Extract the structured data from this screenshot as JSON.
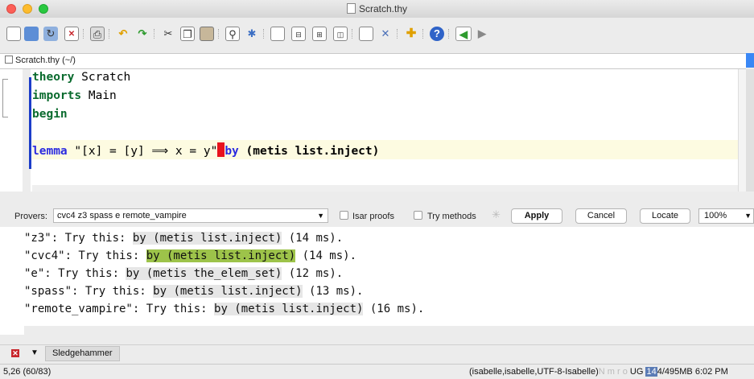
{
  "window": {
    "title": "Scratch.thy"
  },
  "toolbar": {
    "icons": [
      "new-file-icon",
      "open-file-icon",
      "reload-icon",
      "close-file-icon",
      "print-icon",
      "undo-icon",
      "redo-icon",
      "cut-icon",
      "copy-icon",
      "paste-icon",
      "find-icon",
      "find-replace-icon",
      "new-view-icon",
      "fold-icon",
      "unfold-icon",
      "split-icon",
      "buffer-icon",
      "tools-icon",
      "plugin-icon",
      "help-icon",
      "back-icon",
      "forward-icon"
    ]
  },
  "buffer_tab": {
    "label": "Scratch.thy (~/)"
  },
  "editor": {
    "lines": [
      {
        "kw": "theory",
        "rest": " Scratch"
      },
      {
        "kw": "imports",
        "rest": " Main"
      },
      {
        "kw": "begin",
        "rest": ""
      }
    ],
    "lemma": {
      "kw": "lemma",
      "statement": " \"[x] = [y] ⟹ x = y\"",
      "by_kw": "by",
      "method": " (metis list.inject)"
    }
  },
  "sledgehammer": {
    "provers_label": "Provers:",
    "provers_value": "cvc4 z3 spass e remote_vampire",
    "isar_proofs_label": "Isar proofs",
    "try_methods_label": "Try methods",
    "apply_label": "Apply",
    "cancel_label": "Cancel",
    "locate_label": "Locate",
    "zoom": "100%",
    "results": [
      {
        "prefix": "\"z3\": Try this: ",
        "method": "by (metis list.inject)",
        "suffix": " (14 ms).",
        "active": false
      },
      {
        "prefix": "\"cvc4\": Try this: ",
        "method": "by (metis list.inject)",
        "suffix": " (14 ms).",
        "active": true
      },
      {
        "prefix": "\"e\": Try this: ",
        "method": "by (metis the_elem_set)",
        "suffix": " (12 ms).",
        "active": false
      },
      {
        "prefix": "\"spass\": Try this: ",
        "method": "by (metis list.inject)",
        "suffix": " (13 ms).",
        "active": false
      },
      {
        "prefix": "\"remote_vampire\": Try this: ",
        "method": "by (metis list.inject)",
        "suffix": " (16 ms).",
        "active": false
      }
    ],
    "dock_tab": "Sledgehammer"
  },
  "status": {
    "position": "5,26 (60/83)",
    "mode": "(isabelle,isabelle,UTF-8-Isabelle)",
    "flags": "N m r o",
    "ug": "UG",
    "memory_used": "14",
    "memory_rest": "4/495MB",
    "time": "6:02 PM"
  }
}
